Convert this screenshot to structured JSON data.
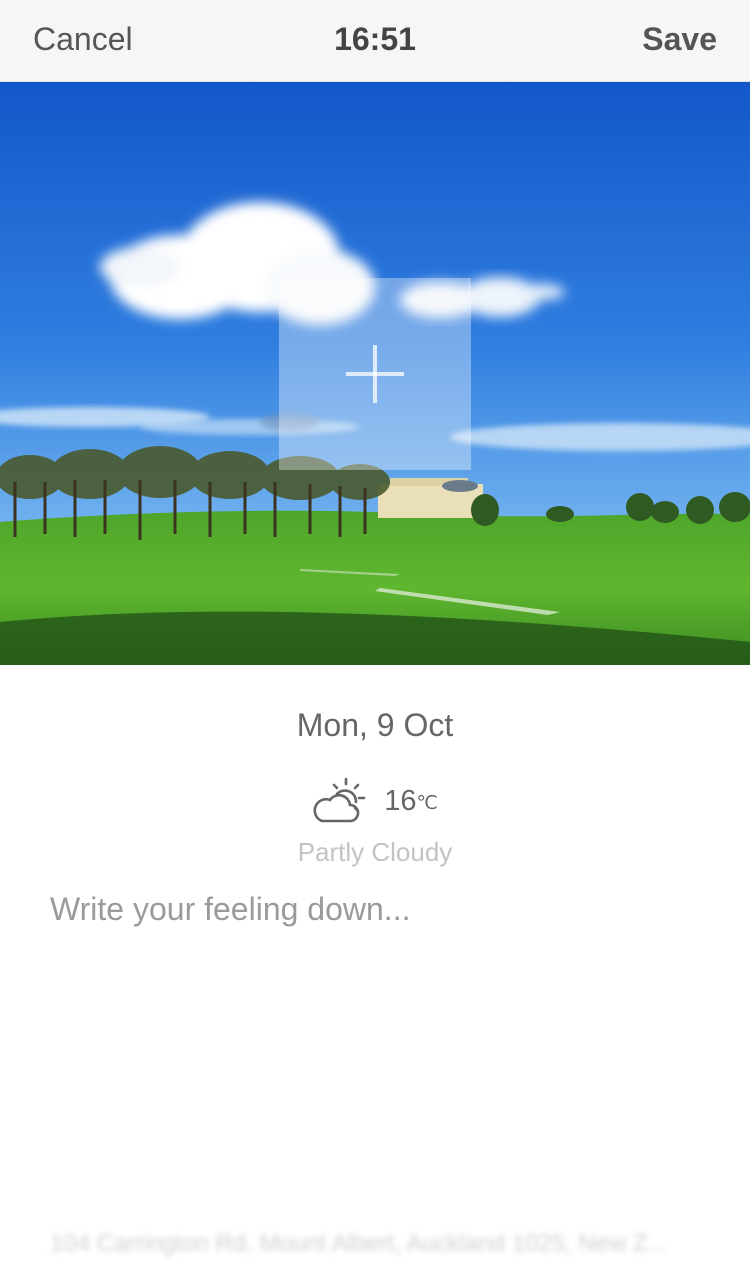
{
  "navbar": {
    "cancel_label": "Cancel",
    "time": "16:51",
    "save_label": "Save"
  },
  "photo": {
    "add_icon": "plus-icon"
  },
  "entry": {
    "date": "Mon, 9 Oct",
    "weather_icon": "partly-cloudy-icon",
    "temperature": "16",
    "temperature_unit": "℃",
    "condition": "Partly Cloudy",
    "feeling_placeholder": "Write your feeling down...",
    "feeling_value": ""
  },
  "location": {
    "text": "104 Carrington Rd, Mount Albert, Auckland 1025, New Z..."
  },
  "colors": {
    "navbar_bg": "#f6f6f6",
    "text_primary": "#555555",
    "text_muted": "#c3c3c3"
  }
}
